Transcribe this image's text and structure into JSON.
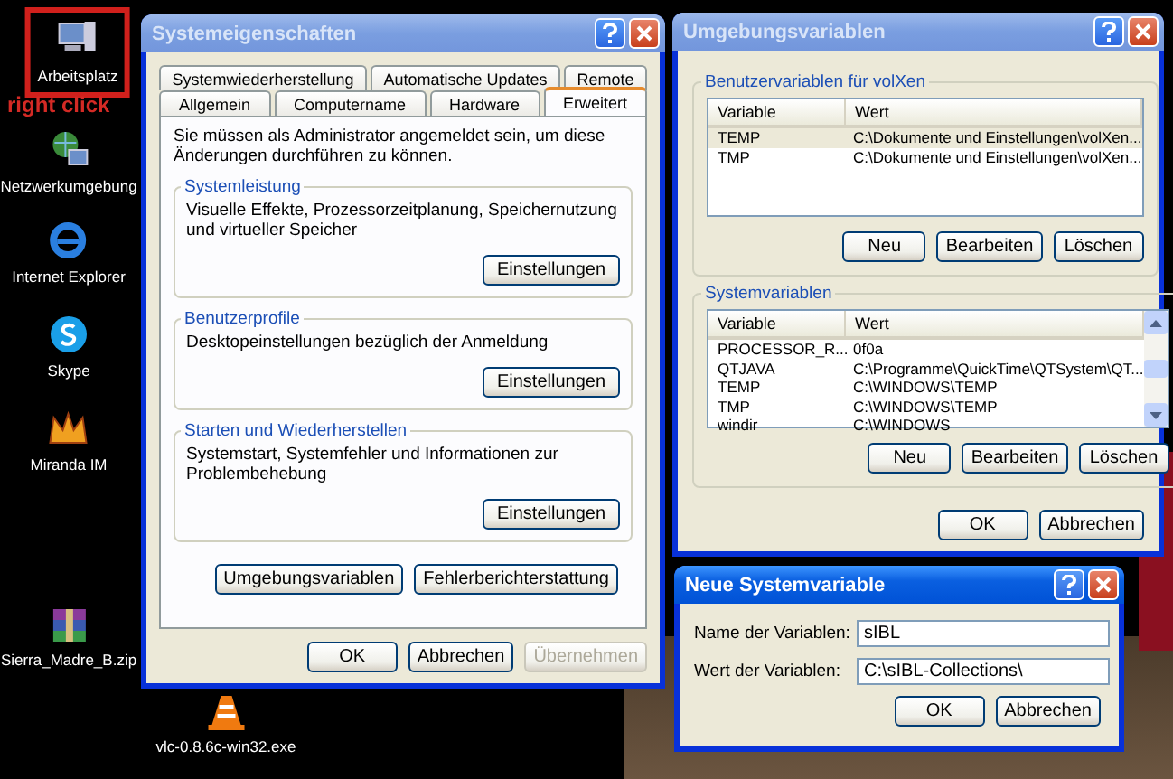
{
  "desktop": {
    "annotation": "right click",
    "icons": [
      {
        "kind": "computer",
        "label": "Arbeitsplatz",
        "highlighted": true
      },
      {
        "kind": "network",
        "label": "Netzwerkumgebung",
        "highlighted": false
      },
      {
        "kind": "browser",
        "label": "Internet Explorer",
        "highlighted": false
      },
      {
        "kind": "skype",
        "label": "Skype",
        "highlighted": false
      },
      {
        "kind": "miranda",
        "label": "Miranda IM",
        "highlighted": false
      },
      {
        "kind": "archive",
        "label": "Sierra_Madre_B.zip",
        "highlighted": false
      },
      {
        "kind": "vlc",
        "label": "vlc-0.8.6c-win32.exe",
        "highlighted": false
      }
    ]
  },
  "system_properties": {
    "title": "Systemeigenschaften",
    "active": false,
    "tab_rows": [
      [
        {
          "label": "Systemwiederherstellung",
          "selected": false
        },
        {
          "label": "Automatische Updates",
          "selected": false
        },
        {
          "label": "Remote",
          "selected": false
        }
      ],
      [
        {
          "label": "Allgemein",
          "selected": false
        },
        {
          "label": "Computername",
          "selected": false
        },
        {
          "label": "Hardware",
          "selected": false
        },
        {
          "label": "Erweitert",
          "selected": true
        }
      ]
    ],
    "intro": "Sie müssen als Administrator angemeldet sein, um diese Änderungen durchführen zu können.",
    "groups": [
      {
        "title": "Systemleistung",
        "text": "Visuelle Effekte, Prozessorzeitplanung, Speichernutzung und virtueller Speicher",
        "button": "Einstellungen"
      },
      {
        "title": "Benutzerprofile",
        "text": "Desktopeinstellungen bezüglich der Anmeldung",
        "button": "Einstellungen"
      },
      {
        "title": "Starten und Wiederherstellen",
        "text": "Systemstart, Systemfehler und Informationen zur Problembehebung",
        "button": "Einstellungen"
      }
    ],
    "extra_buttons": [
      "Umgebungsvariablen",
      "Fehlerberichterstattung"
    ],
    "buttons": [
      {
        "label": "OK",
        "disabled": false
      },
      {
        "label": "Abbrechen",
        "disabled": false
      },
      {
        "label": "Übernehmen",
        "disabled": true
      }
    ]
  },
  "environment_variables": {
    "title": "Umgebungsvariablen",
    "active": false,
    "groups": [
      {
        "title": "Benutzervariablen für volXen",
        "columns": [
          "Variable",
          "Wert"
        ],
        "scrollbar": false,
        "rows": [
          {
            "variable": "TEMP",
            "value": "C:\\Dokumente und Einstellungen\\volXen...",
            "selected": true
          },
          {
            "variable": "TMP",
            "value": "C:\\Dokumente und Einstellungen\\volXen...",
            "selected": false
          }
        ],
        "buttons": [
          "Neu",
          "Bearbeiten",
          "Löschen"
        ]
      },
      {
        "title": "Systemvariablen",
        "columns": [
          "Variable",
          "Wert"
        ],
        "scrollbar": true,
        "rows": [
          {
            "variable": "PROCESSOR_R...",
            "value": "0f0a",
            "selected": false
          },
          {
            "variable": "QTJAVA",
            "value": "C:\\Programme\\QuickTime\\QTSystem\\QT...",
            "selected": false
          },
          {
            "variable": "TEMP",
            "value": "C:\\WINDOWS\\TEMP",
            "selected": false
          },
          {
            "variable": "TMP",
            "value": "C:\\WINDOWS\\TEMP",
            "selected": false
          },
          {
            "variable": "windir",
            "value": "C:\\WINDOWS",
            "selected": false
          }
        ],
        "buttons": [
          "Neu",
          "Bearbeiten",
          "Löschen"
        ]
      }
    ],
    "buttons": [
      "OK",
      "Abbrechen"
    ]
  },
  "new_variable": {
    "title": "Neue Systemvariable",
    "active": true,
    "fields": [
      {
        "label": "Name der Variablen:",
        "value": "sIBL"
      },
      {
        "label": "Wert der Variablen:",
        "value": "C:\\sIBL-Collections\\"
      }
    ],
    "buttons": [
      "OK",
      "Abbrechen"
    ]
  }
}
